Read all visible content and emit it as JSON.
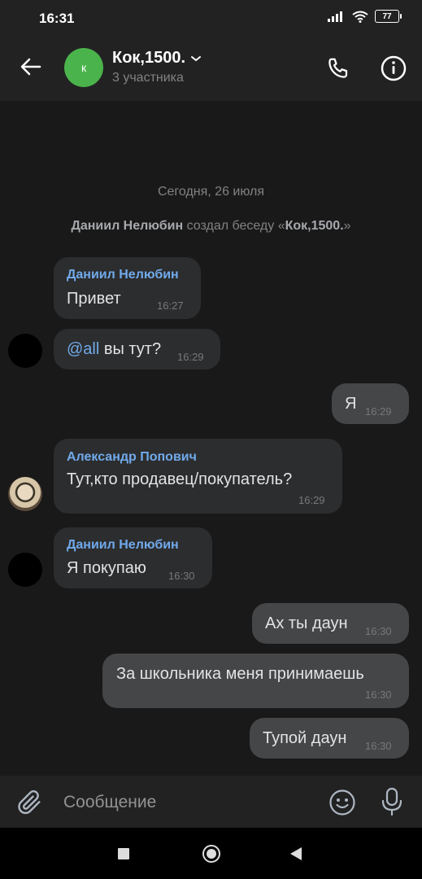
{
  "status_bar": {
    "time": "16:31",
    "battery": "77"
  },
  "header": {
    "title": "Кок,1500.",
    "subtitle": "3 участника",
    "avatar_letter": "к",
    "avatar_color": "#4bb34b"
  },
  "chat": {
    "date": "Сегодня, 26 июля",
    "service": {
      "author": "Даниил Нелюбин",
      "action": "создал беседу «",
      "chat_name": "Кок,1500.",
      "closing": "»"
    },
    "messages": [
      {
        "sender": "Даниил Нелюбин",
        "text": "Привет",
        "time": "16:27"
      },
      {
        "mention": "@all",
        "text": " вы тут?",
        "time": "16:29"
      },
      {
        "text": "Я",
        "time": "16:29"
      },
      {
        "sender": "Александр Попович",
        "text": "Тут,кто продавец/покупатель?",
        "time": "16:29"
      },
      {
        "sender": "Даниил Нелюбин",
        "text": "Я покупаю",
        "time": "16:30"
      },
      {
        "text": "Ах ты даун",
        "time": "16:30"
      },
      {
        "text": "За школьника меня принимаешь",
        "time": "16:30"
      },
      {
        "text": "Тупой даун",
        "time": "16:30"
      }
    ]
  },
  "composer": {
    "placeholder": "Сообщение"
  },
  "colors": {
    "background": "#19191a",
    "bar": "#222223",
    "incoming": "#2c2d2e",
    "outgoing": "#454647",
    "accent": "#71aaeb"
  },
  "icons": [
    "arrow-left-icon",
    "chevron-down-icon",
    "phone-icon",
    "info-icon",
    "paperclip-icon",
    "emoji-icon",
    "microphone-icon",
    "signal-icon",
    "wifi-icon",
    "battery-icon"
  ]
}
